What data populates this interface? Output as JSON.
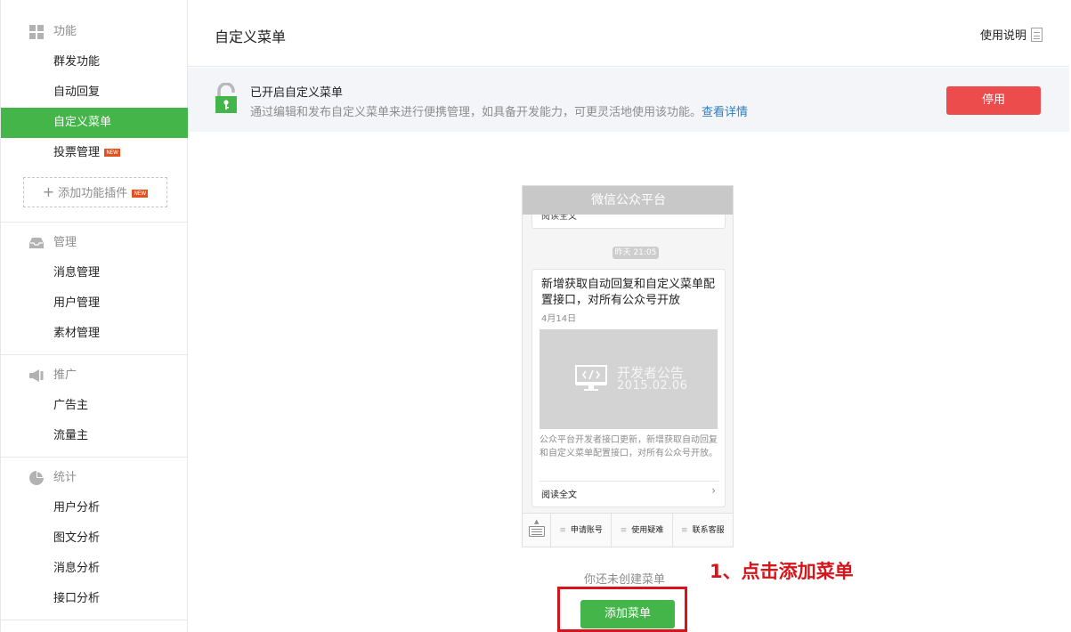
{
  "sidebar": {
    "sections": [
      {
        "title": "功能",
        "icon": "grid-icon",
        "items": [
          {
            "label": "群发功能"
          },
          {
            "label": "自动回复"
          },
          {
            "label": "自定义菜单",
            "active": true
          },
          {
            "label": "投票管理",
            "badge": "NEW"
          }
        ],
        "add_plugin": {
          "label": "添加功能插件",
          "badge": "NEW"
        }
      },
      {
        "title": "管理",
        "icon": "inbox-icon",
        "items": [
          {
            "label": "消息管理"
          },
          {
            "label": "用户管理"
          },
          {
            "label": "素材管理"
          }
        ]
      },
      {
        "title": "推广",
        "icon": "megaphone-icon",
        "items": [
          {
            "label": "广告主"
          },
          {
            "label": "流量主"
          }
        ]
      },
      {
        "title": "统计",
        "icon": "pie-chart-icon",
        "items": [
          {
            "label": "用户分析"
          },
          {
            "label": "图文分析"
          },
          {
            "label": "消息分析"
          },
          {
            "label": "接口分析"
          }
        ]
      }
    ]
  },
  "header": {
    "title": "自定义菜单",
    "help_label": "使用说明"
  },
  "notice": {
    "title": "已开启自定义菜单",
    "desc": "通过编辑和发布自定义菜单来进行便携管理，如具备开发能力，可更灵活地使用该功能。",
    "link": "查看详情",
    "button": "停用"
  },
  "phone": {
    "title": "微信公众平台",
    "prev_card_text": "阅读全文",
    "time": "昨天 21:05",
    "article": {
      "title": "新增获取自动回复和自定义菜单配置接口，对所有公众号开放",
      "date": "4月14日",
      "cover_line1": "开发者公告",
      "cover_line2": "2015.02.06",
      "desc": "公众平台开发者接口更新，新增获取自动回复和自定义菜单配置接口，对所有公众号开放。",
      "read_more": "阅读全文"
    },
    "menu": [
      {
        "label": "申请账号"
      },
      {
        "label": "使用疑难"
      },
      {
        "label": "联系客服"
      }
    ]
  },
  "empty_tip": "你还未创建菜单",
  "add_menu_button": "添加菜单",
  "annotation": "1、点击添加菜单",
  "colors": {
    "brand_green": "#44b549",
    "danger_red": "#ec4c4c",
    "annotation_red": "#d7141a",
    "link_blue": "#2e7dbf"
  }
}
